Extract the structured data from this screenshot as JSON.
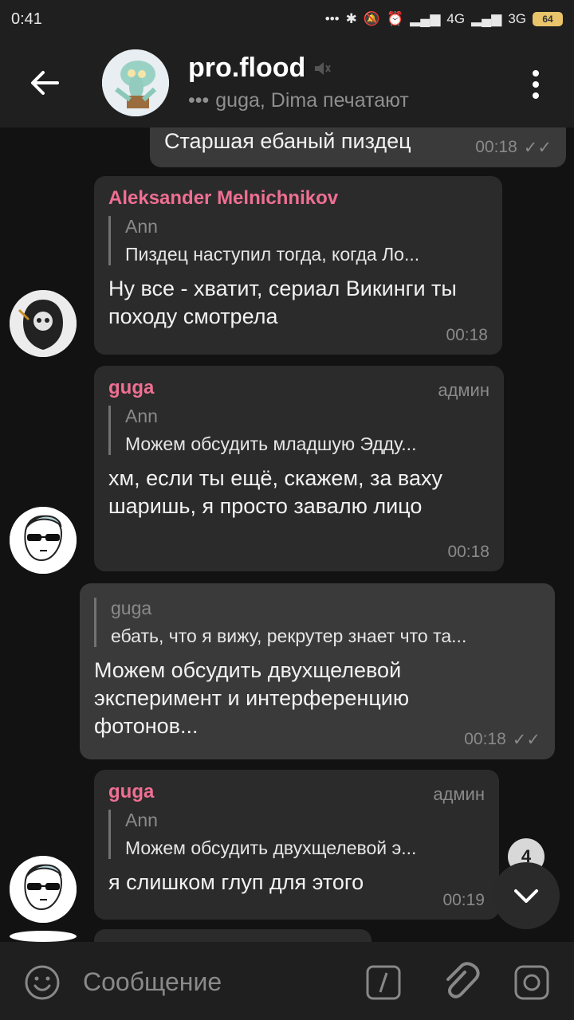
{
  "status_bar": {
    "time": "0:41",
    "signal_1": "4G",
    "signal_2": "3G",
    "battery": "64"
  },
  "header": {
    "title": "pro.flood",
    "status": "guga, Dima печатают"
  },
  "messages": [
    {
      "text": "Старшая ебаный пиздец",
      "time": "00:18"
    },
    {
      "sender": "Aleksander Melnichnikov",
      "reply_name": "Ann",
      "reply_text": "Пиздец наступил тогда, когда Ло...",
      "text": "Ну все - хватит, сериал Викинги ты походу смотрела",
      "time": "00:18"
    },
    {
      "sender": "guga",
      "role": "админ",
      "reply_name": "Ann",
      "reply_text": "Можем обсудить младшую Эдду...",
      "text": "хм, если ты ещё, скажем, за ваху шаришь, я просто завалю лицо",
      "time": "00:18"
    },
    {
      "reply_name": "guga",
      "reply_text": "ебать, что я вижу, рекрутер знает что та...",
      "text": "Можем обсудить двухщелевой эксперимент и интерференцию фотонов...",
      "time": "00:18"
    },
    {
      "sender": "guga",
      "role": "админ",
      "reply_name": "Ann",
      "reply_text": "Можем обсудить двухщелевой э...",
      "text": "я слишком глуп для этого",
      "time": "00:19"
    }
  ],
  "unread_count": "4",
  "input": {
    "placeholder": "Сообщение"
  },
  "icons": {
    "back": "arrow-left-icon",
    "mute": "muted-speaker-icon",
    "menu": "more-vertical-icon",
    "emoji": "smile-icon",
    "command": "slash-command-icon",
    "attach": "paperclip-icon",
    "camera": "camera-icon"
  },
  "colors": {
    "sender_pink": "#ef6f92",
    "background": "#121212",
    "bubble": "#2b2b2b"
  }
}
